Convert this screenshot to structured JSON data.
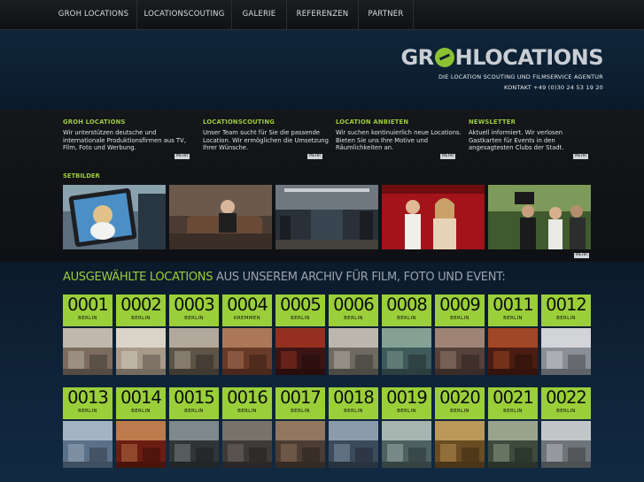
{
  "nav": {
    "items": [
      "GROH LOCATIONS",
      "LOCATIONSCOUTING",
      "GALERIE",
      "REFERENZEN",
      "PARTNER"
    ]
  },
  "header": {
    "logo_part1": "GR",
    "logo_part2": "H",
    "logo_part3": "LOCATIONS",
    "tagline": "DIE LOCATION SCOUTING UND FILMSERVICE AGENTUR",
    "contact": "KONTAKT +49 (0)30 24 53 19 20"
  },
  "info": {
    "columns": [
      {
        "title": "GROH LOCATIONS",
        "text": "Wir unterstützen deutsche und internationale Produktionsfirmen aus TV, Film, Foto und Werbung."
      },
      {
        "title": "LOCATIONSCOUTING",
        "text": "Unser Team sucht für Sie die passende Location. Wir ermöglichen die Umsetzung Ihrer Wünsche."
      },
      {
        "title": "LOCATION ANBIETEN",
        "text": "Wir suchen kontinuierlich neue Locations. Bieten Sie uns Ihre Motive und Räumlichkeiten an."
      },
      {
        "title": "NEWSLETTER",
        "text": "Aktuell informiert. Wir verlosen Gastkarten für Events in den angesagtesten Clubs der Stadt."
      }
    ],
    "more_label": "MEHR"
  },
  "setbilder": {
    "title": "SETBILDER",
    "more_label": "MEHR"
  },
  "locations": {
    "heading_a": "AUSGEWÄHLTE LOCATIONS",
    "heading_b": "AUS UNSEREM ARCHIV FÜR FILM, FOTO UND EVENT:",
    "tiles": [
      {
        "num": "0001",
        "city": "BERLIN"
      },
      {
        "num": "0002",
        "city": "BERLIN"
      },
      {
        "num": "0003",
        "city": "BERLIN"
      },
      {
        "num": "0004",
        "city": "KREMMEN"
      },
      {
        "num": "0005",
        "city": "BERLIN"
      },
      {
        "num": "0006",
        "city": "BERLIN"
      },
      {
        "num": "0008",
        "city": "BERLIN"
      },
      {
        "num": "0009",
        "city": "BERLIN"
      },
      {
        "num": "0011",
        "city": "BERLIN"
      },
      {
        "num": "0012",
        "city": "BERLIN"
      },
      {
        "num": "0013",
        "city": "BERLIN"
      },
      {
        "num": "0014",
        "city": "BERLIN"
      },
      {
        "num": "0015",
        "city": "BERLIN"
      },
      {
        "num": "0016",
        "city": "BERLIN"
      },
      {
        "num": "0017",
        "city": "BERLIN"
      },
      {
        "num": "0018",
        "city": "BERLIN"
      },
      {
        "num": "0019",
        "city": "BERLIN"
      },
      {
        "num": "0020",
        "city": "BERLIN"
      },
      {
        "num": "0021",
        "city": "BERLIN"
      },
      {
        "num": "0022",
        "city": "BERLIN"
      }
    ]
  }
}
